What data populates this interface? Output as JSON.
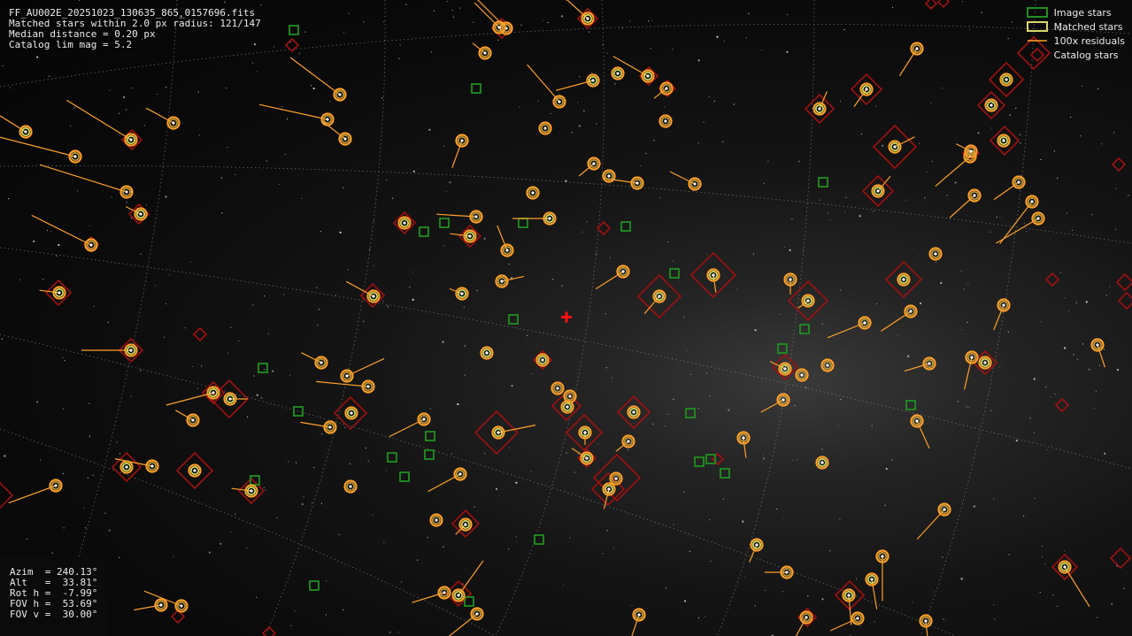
{
  "file_name": "FF_AU002E_20251023_130635_865_0157696.fits",
  "match_summary": "Matched stars within 2.0 px radius: 121/147",
  "median_distance": "Median distance = 0.20 px",
  "catalog_limit": "Catalog lim mag = 5.2",
  "pointing": {
    "azim": "Azim  = 240.13°",
    "alt": "Alt   =  33.81°",
    "rot": "Rot h =  -7.99°",
    "fov_h": "FOV h =  53.69°",
    "fov_v": "FOV v =  30.00°"
  },
  "legend": {
    "image_stars": "Image stars",
    "matched_stars": "Matched stars",
    "residuals": "100x residuals",
    "catalog_stars": "Catalog stars"
  },
  "colors": {
    "image_star": "#1f8f1f",
    "matched_star": "#d8d86a",
    "residual": "#ffa028",
    "catalog_star": "#a01010",
    "center_cross": "#ff1010",
    "grid": "#8a8a8a"
  },
  "icons": {
    "center_marker": "red-cross-icon",
    "image_star_marker": "green-square-icon",
    "matched_star_marker": "yellow-ring-icon",
    "catalog_star_marker": "red-diamond-icon"
  }
}
